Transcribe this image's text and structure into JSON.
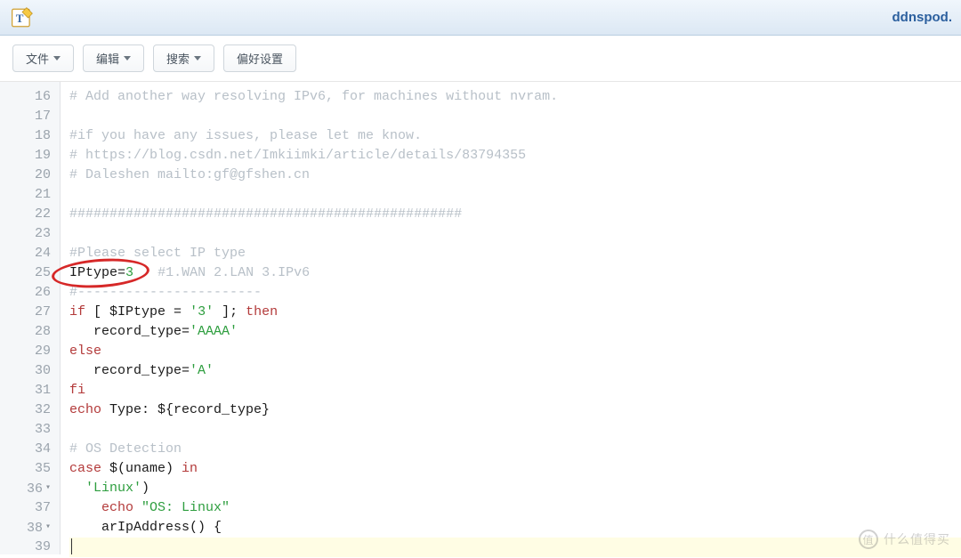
{
  "header": {
    "title_right": "ddnspod."
  },
  "toolbar": {
    "file_label": "文件",
    "edit_label": "编辑",
    "search_label": "搜索",
    "prefs_label": "偏好设置"
  },
  "gutter": {
    "start": 16,
    "end": 39,
    "fold_lines": [
      36,
      38
    ]
  },
  "code": {
    "lines": [
      {
        "n": 16,
        "segs": [
          {
            "t": "# Add another way resolving IPv6, for machines without nvram.",
            "cls": "c-comment"
          }
        ]
      },
      {
        "n": 17,
        "segs": []
      },
      {
        "n": 18,
        "segs": [
          {
            "t": "#if you have any issues, please let me know.",
            "cls": "c-comment"
          }
        ]
      },
      {
        "n": 19,
        "segs": [
          {
            "t": "# https://blog.csdn.net/Imkiimki/article/details/83794355",
            "cls": "c-comment"
          }
        ]
      },
      {
        "n": 20,
        "segs": [
          {
            "t": "# Daleshen mailto:gf@gfshen.cn",
            "cls": "c-comment"
          }
        ]
      },
      {
        "n": 21,
        "segs": []
      },
      {
        "n": 22,
        "segs": [
          {
            "t": "#################################################",
            "cls": "c-comment"
          }
        ]
      },
      {
        "n": 23,
        "segs": []
      },
      {
        "n": 24,
        "segs": [
          {
            "t": "#Please select IP type",
            "cls": "c-comment"
          }
        ]
      },
      {
        "n": 25,
        "annot": true,
        "segs": [
          {
            "t": "IPtype",
            "cls": "c-var"
          },
          {
            "t": "=",
            "cls": "c-op"
          },
          {
            "t": "3",
            "cls": "c-num"
          },
          {
            "t": "   ",
            "cls": ""
          },
          {
            "t": "#1.WAN 2.LAN 3.IPv6",
            "cls": "c-comment"
          }
        ]
      },
      {
        "n": 26,
        "segs": [
          {
            "t": "#-----------------------",
            "cls": "c-comment"
          }
        ]
      },
      {
        "n": 27,
        "segs": [
          {
            "t": "if",
            "cls": "c-keyword"
          },
          {
            "t": " [ ",
            "cls": "c-op"
          },
          {
            "t": "$IPtype",
            "cls": "c-var"
          },
          {
            "t": " = ",
            "cls": "c-op"
          },
          {
            "t": "'3'",
            "cls": "c-string"
          },
          {
            "t": " ]; ",
            "cls": "c-op"
          },
          {
            "t": "then",
            "cls": "c-keyword"
          }
        ]
      },
      {
        "n": 28,
        "segs": [
          {
            "t": "   record_type=",
            "cls": "c-var"
          },
          {
            "t": "'AAAA'",
            "cls": "c-string"
          }
        ]
      },
      {
        "n": 29,
        "segs": [
          {
            "t": "else",
            "cls": "c-keyword"
          }
        ]
      },
      {
        "n": 30,
        "segs": [
          {
            "t": "   record_type=",
            "cls": "c-var"
          },
          {
            "t": "'A'",
            "cls": "c-string"
          }
        ]
      },
      {
        "n": 31,
        "segs": [
          {
            "t": "fi",
            "cls": "c-keyword"
          }
        ]
      },
      {
        "n": 32,
        "segs": [
          {
            "t": "echo",
            "cls": "c-builtin"
          },
          {
            "t": " Type: ",
            "cls": "c-var"
          },
          {
            "t": "${record_type}",
            "cls": "c-var"
          }
        ]
      },
      {
        "n": 33,
        "segs": []
      },
      {
        "n": 34,
        "segs": [
          {
            "t": "# OS Detection",
            "cls": "c-comment"
          }
        ]
      },
      {
        "n": 35,
        "segs": [
          {
            "t": "case",
            "cls": "c-keyword"
          },
          {
            "t": " $(uname) ",
            "cls": "c-var"
          },
          {
            "t": "in",
            "cls": "c-keyword"
          }
        ]
      },
      {
        "n": 36,
        "segs": [
          {
            "t": "  ",
            "cls": ""
          },
          {
            "t": "'Linux'",
            "cls": "c-string"
          },
          {
            "t": ")",
            "cls": "c-op"
          }
        ]
      },
      {
        "n": 37,
        "segs": [
          {
            "t": "    ",
            "cls": ""
          },
          {
            "t": "echo",
            "cls": "c-builtin"
          },
          {
            "t": " ",
            "cls": ""
          },
          {
            "t": "\"OS: Linux\"",
            "cls": "c-string"
          }
        ]
      },
      {
        "n": 38,
        "segs": [
          {
            "t": "    ",
            "cls": ""
          },
          {
            "t": "arIpAddress",
            "cls": "c-func"
          },
          {
            "t": "() {",
            "cls": "c-op"
          }
        ]
      },
      {
        "n": 39,
        "current": true,
        "segs": []
      }
    ]
  },
  "watermark": {
    "text": "什么值得买"
  }
}
